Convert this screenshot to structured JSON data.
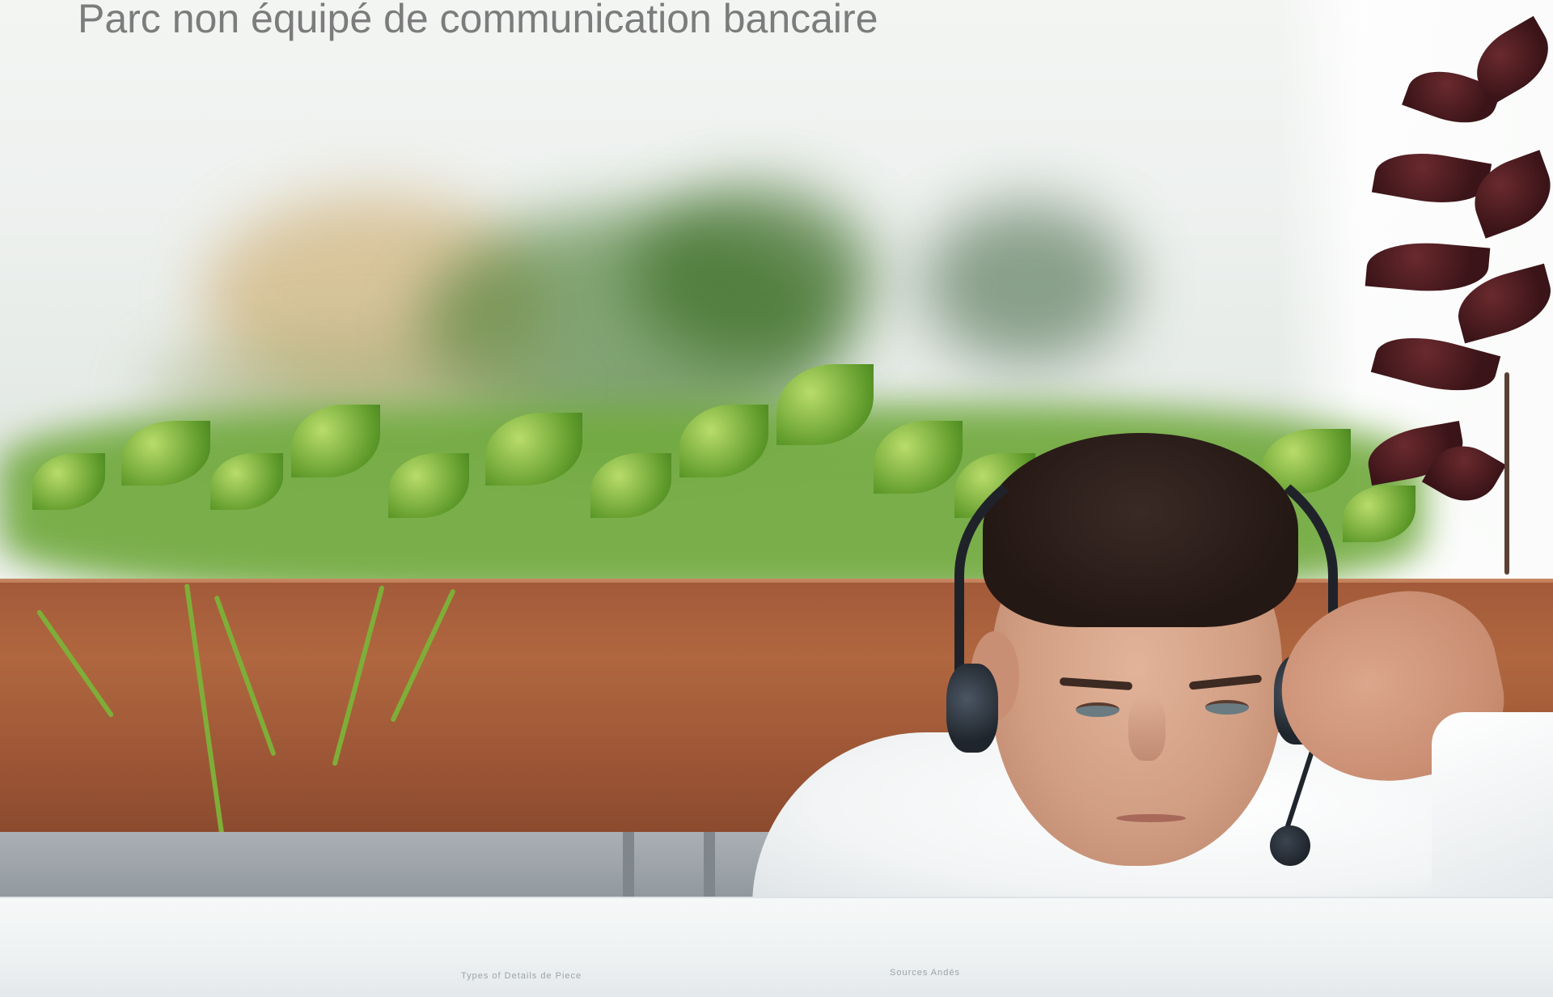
{
  "slide": {
    "title": "Parc non équipé de communication bancaire"
  },
  "monitor": {
    "text_left": "Types of Details de Piece",
    "text_right": "Sources Andés"
  },
  "colors": {
    "title_text": "#7c7c7c",
    "planter": "#a35a3a",
    "foliage": "#5e9a2a",
    "shirt": "#f2f4f5"
  }
}
